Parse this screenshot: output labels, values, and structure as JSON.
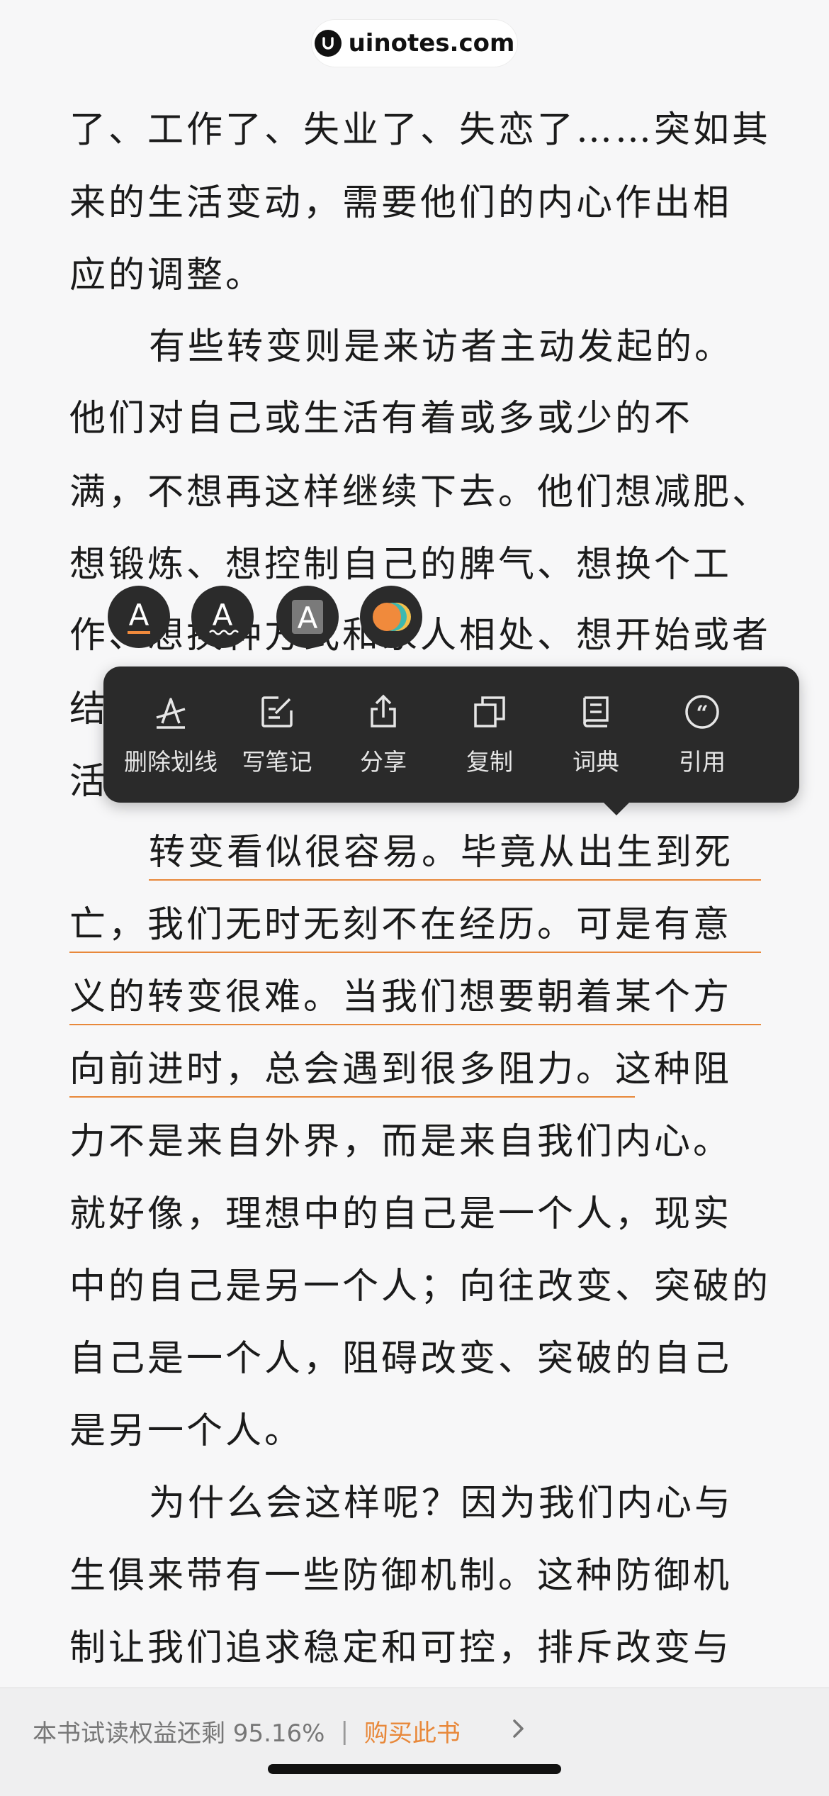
{
  "watermark": {
    "text": "uinotes.com"
  },
  "reader": {
    "lines": [
      "了、工作了、失业了、失恋了……突如其",
      "来的生活变动，需要他们的内心作出相",
      "应的调整。",
      "有些转变则是来访者主动发起的。",
      "他们对自己或生活有着或多或少的不",
      "满，不想再这样继续下去。他们想减肥、",
      "想锻炼、想控制自己的脾气、想换个工",
      "作、想换种方式和家人相处、想开始或者",
      "结",
      "活",
      "转变看似很容易。毕竟从出生到死",
      "亡，我们无时无刻不在经历。可是有意",
      "义的转变很难。当我们想要朝着某个方",
      "向前进时，总会遇到很多阻力。这种阻",
      "力不是来自外界，而是来自我们内心。",
      "就好像，理想中的自己是一个人，现实",
      "中的自己是另一个人；向往改变、突破的",
      "自己是一个人，阻碍改变、突破的自己",
      "是另一个人。",
      "为什么会这样呢？因为我们内心与",
      "生俱来带有一些防御机制。这种防御机",
      "制让我们追求稳定和可控，排斥改变与"
    ]
  },
  "highlight_styles": {
    "items": [
      {
        "label": "A",
        "name": "underline-style"
      },
      {
        "label": "A",
        "name": "wavy-style"
      },
      {
        "label": "A",
        "name": "fill-style"
      },
      {
        "label": "",
        "name": "color-style"
      }
    ],
    "colors": {
      "orange": "#f08a3c",
      "teal": "#3cb9b0",
      "yellow": "#f2c14e"
    }
  },
  "menu": {
    "items": [
      {
        "label": "删除划线",
        "icon": "strikethrough-icon"
      },
      {
        "label": "写笔记",
        "icon": "edit-note-icon"
      },
      {
        "label": "分享",
        "icon": "share-icon"
      },
      {
        "label": "复制",
        "icon": "copy-icon"
      },
      {
        "label": "词典",
        "icon": "dictionary-icon"
      },
      {
        "label": "引用",
        "icon": "quote-icon"
      }
    ]
  },
  "bottom_bar": {
    "trial_text": "本书试读权益还剩 95.16%",
    "separator": "|",
    "buy_label": "购买此书"
  },
  "colors": {
    "accent": "#e8883a",
    "menu_bg": "#2a2a2a",
    "page_bg": "#f7f7f8"
  }
}
